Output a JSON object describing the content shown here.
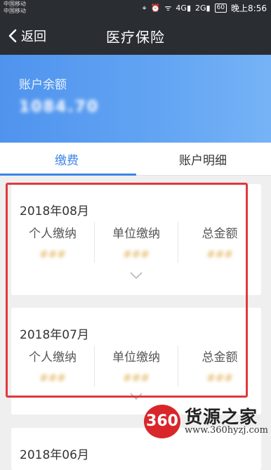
{
  "status_bar": {
    "carrier1": "中国移动",
    "carrier2": "中国移动",
    "network1": "4G",
    "network2": "2G",
    "battery": "60",
    "time": "晚上8:56"
  },
  "header": {
    "back_label": "返回",
    "title": "医疗保险"
  },
  "balance": {
    "label": "账户余额",
    "value": "1084.70"
  },
  "tabs": [
    {
      "label": "缴费",
      "active": true
    },
    {
      "label": "账户明细",
      "active": false
    }
  ],
  "records": [
    {
      "month": "2018年08月",
      "columns": [
        {
          "label": "个人缴纳",
          "value": "###"
        },
        {
          "label": "单位缴纳",
          "value": "###"
        },
        {
          "label": "总金额",
          "value": "###"
        }
      ]
    },
    {
      "month": "2018年07月",
      "columns": [
        {
          "label": "个人缴纳",
          "value": "###"
        },
        {
          "label": "单位缴纳",
          "value": "###"
        },
        {
          "label": "总金额",
          "value": "###"
        }
      ]
    },
    {
      "month": "2018年06月"
    }
  ],
  "watermark": {
    "logo": "360",
    "name": "货源之家",
    "url": "www.360hyzj.com"
  },
  "colors": {
    "header_bg": "#2a2e33",
    "accent": "#3a86e8",
    "highlight": "#e0393e",
    "watermark_red": "#d9262b"
  }
}
